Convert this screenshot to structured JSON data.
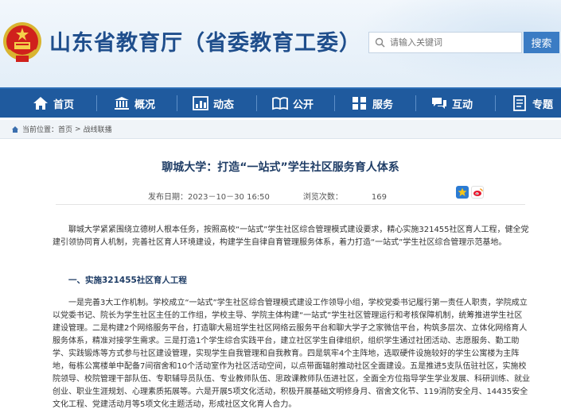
{
  "header": {
    "site_title": "山东省教育厅（省委教育工委）",
    "search_placeholder": "请输入关键词",
    "search_button": "搜索",
    "brand_color": "#1f5a9e"
  },
  "nav": {
    "items": [
      {
        "label": "首页",
        "icon": "home-icon"
      },
      {
        "label": "概况",
        "icon": "building-icon"
      },
      {
        "label": "动态",
        "icon": "chart-icon"
      },
      {
        "label": "公开",
        "icon": "book-icon"
      },
      {
        "label": "服务",
        "icon": "grid-icon"
      },
      {
        "label": "互动",
        "icon": "chat-icon"
      },
      {
        "label": "专题",
        "icon": "document-icon"
      }
    ]
  },
  "breadcrumb": {
    "prefix": "当前位置：",
    "items": [
      "首页",
      "战线联播"
    ],
    "separator": ">"
  },
  "article": {
    "title": "聊城大学：打造“一站式”学生社区服务育人体系",
    "publish_label": "发布日期：",
    "publish_time": "2023－10－30 16:50",
    "views_label": "浏览次数：",
    "views": "169",
    "paragraph1": "聊城大学紧紧围绕立德树人根本任务，按照高校“一站式”学生社区综合管理模式建设要求，精心实施321455社区育人工程，健全党建引领协同育人机制，完善社区育人环境建设，构建学生自律自育管理服务体系，着力打造“一站式”学生社区综合管理示范基地。",
    "heading1": "一、实施321455社区育人工程",
    "paragraph2": "一是完善3大工作机制。学校成立“一站式”学生社区综合管理模式建设工作领导小组，学校党委书记履行第一责任人职责，学院成立以党委书记、院长为学生社区主任的工作组，学校主导、学院主体构建“一站式”学生社区管理运行和考核保障机制，统筹推进学生社区建设管理。二是构建2个网络服务平台，打造聊大易班学生社区网络云服务平台和聊大学子之家微信平台，构筑多层次、立体化网络育人服务体系，精准对接学生需求。三是打造1个学生综合实践平台，建立社区学生自律组织，组织学生通过社团活动、志愿服务、勤工助学、实践锻炼等方式参与社区建设管理，实现学生自我管理和自我教育。四是筑牢4个主阵地，选取硬件设施较好的学生公寓楼为主阵地，每栋公寓楼单中配备7间宿舍和10个活动室作为社区活动空间，以点带面辐射推动社区全面建设。五是推进5支队伍驻社区，实施校院领导、校院管理干部队伍、专职辅导员队伍、专业教师队伍、思政课教师队伍进社区，全面全方位指导学生学业发展、科研训练、就业创业、职业生涯规划、心理素质拓展等。六是开展5项文化活动，积极开展基础文明修身月、宿舍文化节、119消防安全月、14435安全文化工程、党建活动月等5项文化主题活动，形成社区文化育人合力。"
  }
}
